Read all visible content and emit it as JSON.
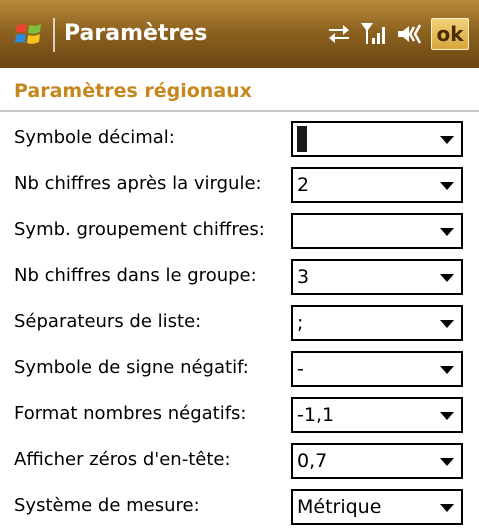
{
  "titlebar": {
    "title": "Paramètres",
    "ok_label": "ok",
    "icons": [
      "windows-start-icon",
      "connectivity-icon",
      "signal-icon",
      "volume-icon"
    ],
    "accent_color": "#8e6320"
  },
  "section": {
    "title": "Paramètres régionaux",
    "title_color": "#c6871c"
  },
  "rows": [
    {
      "label": "Symbole décimal:",
      "value": "",
      "selected": true
    },
    {
      "label": "Nb chiffres après la virgule:",
      "value": "2"
    },
    {
      "label": "Symb. groupement chiffres:",
      "value": ""
    },
    {
      "label": "Nb chiffres dans le groupe:",
      "value": "3"
    },
    {
      "label": "Séparateurs de liste:",
      "value": ";"
    },
    {
      "label": "Symbole de signe négatif:",
      "value": "-"
    },
    {
      "label": "Format nombres négatifs:",
      "value": "-1,1"
    },
    {
      "label": "Afficher zéros d'en-tête:",
      "value": "0,7"
    },
    {
      "label": "Système de mesure:",
      "value": "Métrique"
    }
  ]
}
